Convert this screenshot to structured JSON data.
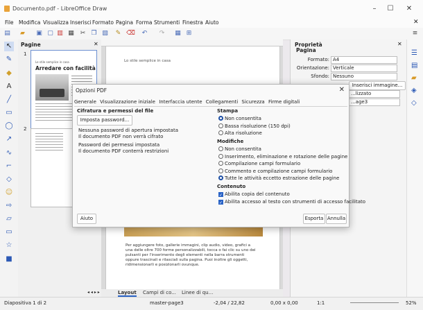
{
  "window": {
    "title": "Documento.pdf - LibreOffice Draw",
    "minimize": "–",
    "maximize": "☐",
    "close": "✕"
  },
  "menu": [
    "File",
    "Modifica",
    "Visualizza",
    "Inserisci",
    "Formato",
    "Pagina",
    "Forma",
    "Strumenti",
    "Finestra",
    "Aiuto"
  ],
  "pages_panel": {
    "title": "Pagine",
    "page1_number": "1",
    "page2_number": "2",
    "page1_heading": "Arredare con facilità",
    "page1_small": "Le stile semplice in casa"
  },
  "document": {
    "top_text": "Lo stile semplice in casa",
    "lower_text": "Per aggiungere foto, gallerie immagini, clip audio, video, grafici a una delle oltre 700 forme personalizzabili, tocca o fai clic su uno dei pulsanti per l'inserimento degli elementi nella barra strumenti oppure trascinali e rilasciali sulla pagina. Puoi inoltre gli oggetti, ridimensionarli e posizionarli ovunque."
  },
  "sheet_tabs": [
    "Layout",
    "Campi di co...",
    "Linee di qu..."
  ],
  "properties": {
    "title": "Proprietà",
    "section": "Pagina",
    "formato_label": "Formato:",
    "formato_value": "A4",
    "orientazione_label": "Orientazione:",
    "orientazione_value": "Verticale",
    "sfondo_label": "Sfondo:",
    "sfondo_value": "Nessuno",
    "inserisci_btn": "Inserisci immagine...",
    "layout_value": "...lizzato",
    "master_value": "...age3"
  },
  "status": {
    "left": "Diapositiva 1 di 2",
    "master": "master-page3",
    "position": "-2,04 / 22,82",
    "size": "0,00 x 0,00",
    "ratio": "1:1",
    "zoom": "52%"
  },
  "dialog": {
    "title": "Opzioni PDF",
    "tabs": [
      "Generale",
      "Visualizzazione iniziale",
      "Interfaccia utente",
      "Collegamenti",
      "Sicurezza",
      "Firme digitali"
    ],
    "enc_section": "Cifratura e permessi del file",
    "set_password_btn": "Imposta password...",
    "no_open_pw_1": "Nessuna password di apertura impostata",
    "no_open_pw_2": "Il documento PDF non verrà cifrato",
    "perm_pw_1": "Password dei permessi impostata",
    "perm_pw_2": "Il documento PDF conterrà restrizioni",
    "print_section": "Stampa",
    "print_options": [
      {
        "label": "Non consentita",
        "checked": true
      },
      {
        "label": "Bassa risoluzione (150 dpi)",
        "checked": false
      },
      {
        "label": "Alta risoluzione",
        "checked": false
      }
    ],
    "modify_section": "Modifiche",
    "modify_options": [
      {
        "label": "Non consentita",
        "checked": false
      },
      {
        "label": "Inserimento, eliminazione e rotazione delle pagine",
        "checked": false
      },
      {
        "label": "Compilazione campi formulario",
        "checked": false
      },
      {
        "label": "Commento e compilazione campi formulario",
        "checked": false
      },
      {
        "label": "Tutte le attività eccetto estrazione delle pagine",
        "checked": true
      }
    ],
    "content_section": "Contenuto",
    "content_options": [
      {
        "label": "Abilita copia del contenuto",
        "checked": true
      },
      {
        "label": "Abilita accesso al testo con strumenti di accesso facilitato",
        "checked": true
      }
    ],
    "help_btn": "Aiuto",
    "export_btn": "Esporta",
    "cancel_btn": "Annulla"
  }
}
